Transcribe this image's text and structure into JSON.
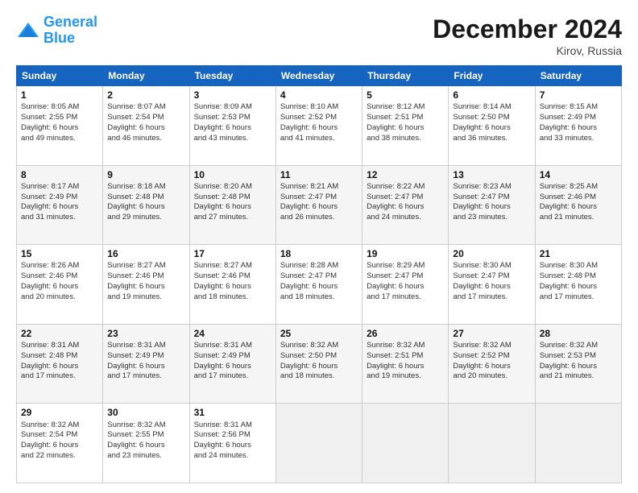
{
  "header": {
    "logo_line1": "General",
    "logo_line2": "Blue",
    "month_title": "December 2024",
    "location": "Kirov, Russia"
  },
  "days_of_week": [
    "Sunday",
    "Monday",
    "Tuesday",
    "Wednesday",
    "Thursday",
    "Friday",
    "Saturday"
  ],
  "weeks": [
    [
      {
        "day": "1",
        "lines": [
          "Sunrise: 8:05 AM",
          "Sunset: 2:55 PM",
          "Daylight: 6 hours",
          "and 49 minutes."
        ]
      },
      {
        "day": "2",
        "lines": [
          "Sunrise: 8:07 AM",
          "Sunset: 2:54 PM",
          "Daylight: 6 hours",
          "and 46 minutes."
        ]
      },
      {
        "day": "3",
        "lines": [
          "Sunrise: 8:09 AM",
          "Sunset: 2:53 PM",
          "Daylight: 6 hours",
          "and 43 minutes."
        ]
      },
      {
        "day": "4",
        "lines": [
          "Sunrise: 8:10 AM",
          "Sunset: 2:52 PM",
          "Daylight: 6 hours",
          "and 41 minutes."
        ]
      },
      {
        "day": "5",
        "lines": [
          "Sunrise: 8:12 AM",
          "Sunset: 2:51 PM",
          "Daylight: 6 hours",
          "and 38 minutes."
        ]
      },
      {
        "day": "6",
        "lines": [
          "Sunrise: 8:14 AM",
          "Sunset: 2:50 PM",
          "Daylight: 6 hours",
          "and 36 minutes."
        ]
      },
      {
        "day": "7",
        "lines": [
          "Sunrise: 8:15 AM",
          "Sunset: 2:49 PM",
          "Daylight: 6 hours",
          "and 33 minutes."
        ]
      }
    ],
    [
      {
        "day": "8",
        "lines": [
          "Sunrise: 8:17 AM",
          "Sunset: 2:49 PM",
          "Daylight: 6 hours",
          "and 31 minutes."
        ]
      },
      {
        "day": "9",
        "lines": [
          "Sunrise: 8:18 AM",
          "Sunset: 2:48 PM",
          "Daylight: 6 hours",
          "and 29 minutes."
        ]
      },
      {
        "day": "10",
        "lines": [
          "Sunrise: 8:20 AM",
          "Sunset: 2:48 PM",
          "Daylight: 6 hours",
          "and 27 minutes."
        ]
      },
      {
        "day": "11",
        "lines": [
          "Sunrise: 8:21 AM",
          "Sunset: 2:47 PM",
          "Daylight: 6 hours",
          "and 26 minutes."
        ]
      },
      {
        "day": "12",
        "lines": [
          "Sunrise: 8:22 AM",
          "Sunset: 2:47 PM",
          "Daylight: 6 hours",
          "and 24 minutes."
        ]
      },
      {
        "day": "13",
        "lines": [
          "Sunrise: 8:23 AM",
          "Sunset: 2:47 PM",
          "Daylight: 6 hours",
          "and 23 minutes."
        ]
      },
      {
        "day": "14",
        "lines": [
          "Sunrise: 8:25 AM",
          "Sunset: 2:46 PM",
          "Daylight: 6 hours",
          "and 21 minutes."
        ]
      }
    ],
    [
      {
        "day": "15",
        "lines": [
          "Sunrise: 8:26 AM",
          "Sunset: 2:46 PM",
          "Daylight: 6 hours",
          "and 20 minutes."
        ]
      },
      {
        "day": "16",
        "lines": [
          "Sunrise: 8:27 AM",
          "Sunset: 2:46 PM",
          "Daylight: 6 hours",
          "and 19 minutes."
        ]
      },
      {
        "day": "17",
        "lines": [
          "Sunrise: 8:27 AM",
          "Sunset: 2:46 PM",
          "Daylight: 6 hours",
          "and 18 minutes."
        ]
      },
      {
        "day": "18",
        "lines": [
          "Sunrise: 8:28 AM",
          "Sunset: 2:47 PM",
          "Daylight: 6 hours",
          "and 18 minutes."
        ]
      },
      {
        "day": "19",
        "lines": [
          "Sunrise: 8:29 AM",
          "Sunset: 2:47 PM",
          "Daylight: 6 hours",
          "and 17 minutes."
        ]
      },
      {
        "day": "20",
        "lines": [
          "Sunrise: 8:30 AM",
          "Sunset: 2:47 PM",
          "Daylight: 6 hours",
          "and 17 minutes."
        ]
      },
      {
        "day": "21",
        "lines": [
          "Sunrise: 8:30 AM",
          "Sunset: 2:48 PM",
          "Daylight: 6 hours",
          "and 17 minutes."
        ]
      }
    ],
    [
      {
        "day": "22",
        "lines": [
          "Sunrise: 8:31 AM",
          "Sunset: 2:48 PM",
          "Daylight: 6 hours",
          "and 17 minutes."
        ]
      },
      {
        "day": "23",
        "lines": [
          "Sunrise: 8:31 AM",
          "Sunset: 2:49 PM",
          "Daylight: 6 hours",
          "and 17 minutes."
        ]
      },
      {
        "day": "24",
        "lines": [
          "Sunrise: 8:31 AM",
          "Sunset: 2:49 PM",
          "Daylight: 6 hours",
          "and 17 minutes."
        ]
      },
      {
        "day": "25",
        "lines": [
          "Sunrise: 8:32 AM",
          "Sunset: 2:50 PM",
          "Daylight: 6 hours",
          "and 18 minutes."
        ]
      },
      {
        "day": "26",
        "lines": [
          "Sunrise: 8:32 AM",
          "Sunset: 2:51 PM",
          "Daylight: 6 hours",
          "and 19 minutes."
        ]
      },
      {
        "day": "27",
        "lines": [
          "Sunrise: 8:32 AM",
          "Sunset: 2:52 PM",
          "Daylight: 6 hours",
          "and 20 minutes."
        ]
      },
      {
        "day": "28",
        "lines": [
          "Sunrise: 8:32 AM",
          "Sunset: 2:53 PM",
          "Daylight: 6 hours",
          "and 21 minutes."
        ]
      }
    ],
    [
      {
        "day": "29",
        "lines": [
          "Sunrise: 8:32 AM",
          "Sunset: 2:54 PM",
          "Daylight: 6 hours",
          "and 22 minutes."
        ]
      },
      {
        "day": "30",
        "lines": [
          "Sunrise: 8:32 AM",
          "Sunset: 2:55 PM",
          "Daylight: 6 hours",
          "and 23 minutes."
        ]
      },
      {
        "day": "31",
        "lines": [
          "Sunrise: 8:31 AM",
          "Sunset: 2:56 PM",
          "Daylight: 6 hours",
          "and 24 minutes."
        ]
      },
      null,
      null,
      null,
      null
    ]
  ]
}
